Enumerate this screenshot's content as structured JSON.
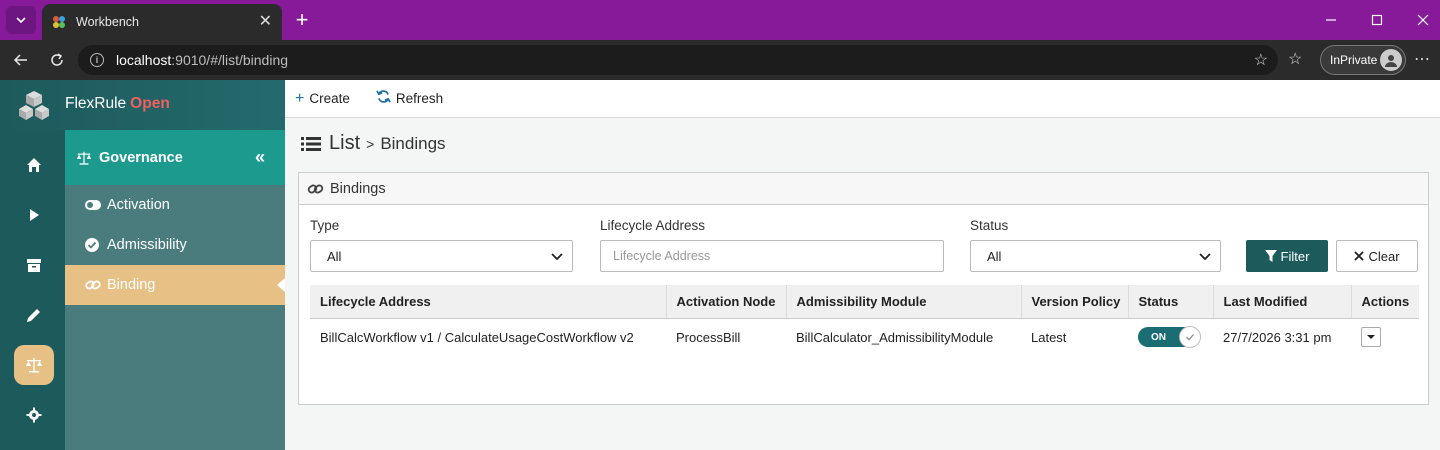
{
  "browser": {
    "tab_title": "Workbench",
    "url_host": "localhost",
    "url_path": ":9010/#/list/binding",
    "profile_label": "InPrivate"
  },
  "brand": {
    "name": "FlexRule",
    "edition": "Open"
  },
  "rail": {
    "items": [
      {
        "icon": "home-icon"
      },
      {
        "icon": "play-icon"
      },
      {
        "icon": "archive-icon"
      },
      {
        "icon": "pencil-icon"
      },
      {
        "icon": "scale-icon",
        "active": true
      },
      {
        "icon": "gear-icon"
      }
    ]
  },
  "submenu": {
    "title": "Governance",
    "items": [
      {
        "label": "Activation",
        "icon": "toggle-icon"
      },
      {
        "label": "Admissibility",
        "icon": "check-circle-icon"
      },
      {
        "label": "Binding",
        "icon": "link-icon",
        "active": true
      }
    ]
  },
  "toolbar": {
    "create_label": "Create",
    "refresh_label": "Refresh"
  },
  "page": {
    "title": "List",
    "separator": ">",
    "subtitle": "Bindings"
  },
  "panel": {
    "title": "Bindings"
  },
  "filters": {
    "type": {
      "label": "Type",
      "value": "All"
    },
    "lifecycle": {
      "label": "Lifecycle Address",
      "placeholder": "Lifecycle Address"
    },
    "status": {
      "label": "Status",
      "value": "All"
    },
    "filter_label": "Filter",
    "clear_label": "Clear"
  },
  "table": {
    "columns": [
      "Lifecycle Address",
      "Activation Node",
      "Admissibility Module",
      "Version Policy",
      "Status",
      "Last Modified",
      "Actions"
    ],
    "rows": [
      {
        "lifecycle_address": "BillCalcWorkflow v1 / CalculateUsageCostWorkflow v2",
        "activation_node": "ProcessBill",
        "admissibility_module": "BillCalculator_AdmissibilityModule",
        "version_policy": "Latest",
        "status": "ON",
        "last_modified": "27/7/2026 3:31 pm"
      }
    ]
  },
  "colors": {
    "titlebar": "#861a98",
    "rail": "#1d5a5c",
    "submenu_header": "#1c9a8e",
    "submenu_bg": "#4a7c7e",
    "active": "#e7c085",
    "brand_open": "#f0605d",
    "primary_button": "#1d5a5c"
  }
}
